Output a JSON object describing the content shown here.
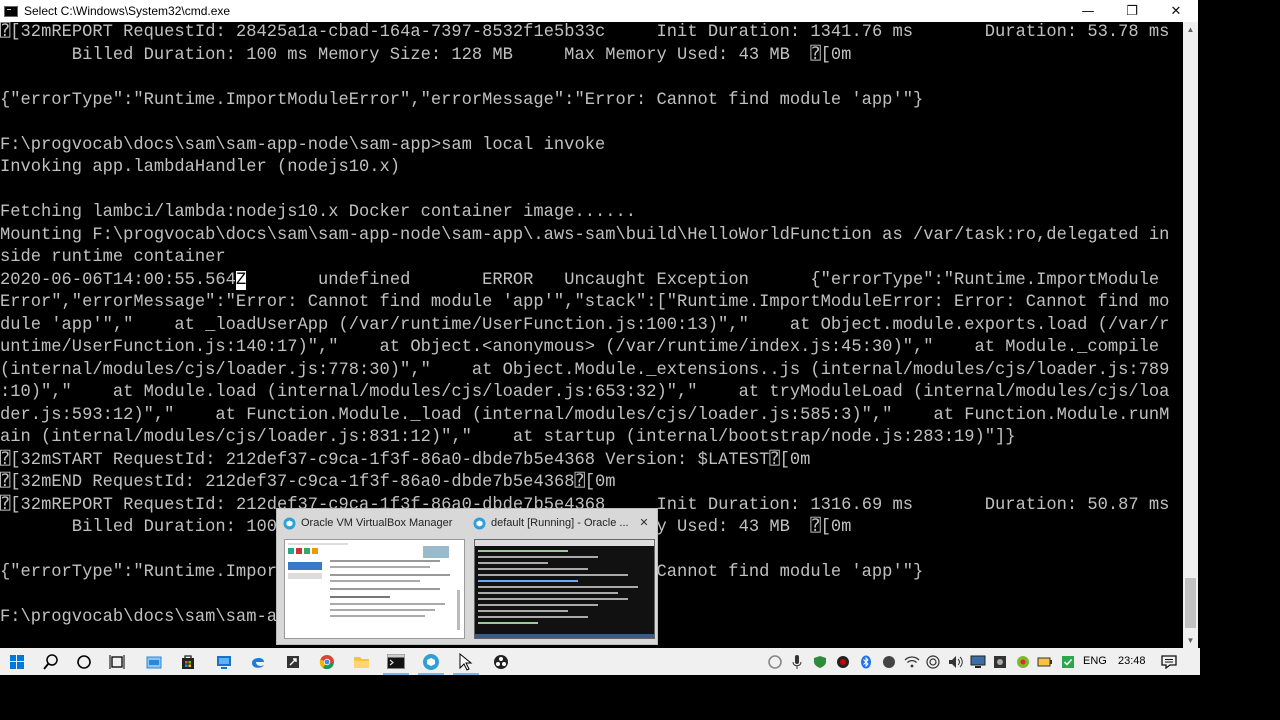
{
  "window": {
    "title": "Select C:\\Windows\\System32\\cmd.exe",
    "minimize_glyph": "—",
    "restore_glyph": "❐",
    "close_glyph": "✕"
  },
  "console": {
    "lines": [
      "\u0000[32mREPORT RequestId: 28425a1a-cbad-164a-7397-8532f1e5b33c     Init Duration: 1341.76 ms       Duration: 53.78 ms",
      "       Billed Duration: 100 ms Memory Size: 128 MB     Max Memory Used: 43 MB  \u0000[0m",
      "",
      "{\"errorType\":\"Runtime.ImportModuleError\",\"errorMessage\":\"Error: Cannot find module 'app'\"}",
      "",
      "F:\\progvocab\\docs\\sam\\sam-app-node\\sam-app>sam local invoke",
      "Invoking app.lambdaHandler (nodejs10.x)",
      "",
      "Fetching lambci/lambda:nodejs10.x Docker container image......",
      "Mounting F:\\progvocab\\docs\\sam\\sam-app-node\\sam-app\\.aws-sam\\build\\HelloWorldFunction as /var/task:ro,delegated in",
      "side runtime container",
      "2020-06-06T14:00:55.564",
      "Error\",\"errorMessage\":\"Error: Cannot find module 'app'\",\"stack\":[\"Runtime.ImportModuleError: Error: Cannot find mo",
      "dule 'app'\",\"    at _loadUserApp (/var/runtime/UserFunction.js:100:13)\",\"    at Object.module.exports.load (/var/r",
      "untime/UserFunction.js:140:17)\",\"    at Object.<anonymous> (/var/runtime/index.js:45:30)\",\"    at Module._compile",
      "(internal/modules/cjs/loader.js:778:30)\",\"    at Object.Module._extensions..js (internal/modules/cjs/loader.js:789",
      ":10)\",\"    at Module.load (internal/modules/cjs/loader.js:653:32)\",\"    at tryModuleLoad (internal/modules/cjs/loa",
      "der.js:593:12)\",\"    at Function.Module._load (internal/modules/cjs/loader.js:585:3)\",\"    at Function.Module.runM",
      "ain (internal/modules/cjs/loader.js:831:12)\",\"    at startup (internal/bootstrap/node.js:283:19)\"]}",
      "\u0000[32mSTART RequestId: 212def37-c9ca-1f3f-86a0-dbde7b5e4368 Version: $LATEST\u0000[0m",
      "\u0000[32mEND RequestId: 212def37-c9ca-1f3f-86a0-dbde7b5e4368\u0000[0m",
      "\u0000[32mREPORT RequestId: 212def37-c9ca-1f3f-86a0-dbde7b5e4368     Init Duration: 1316.69 ms       Duration: 50.87 ms",
      "       Billed Duration: 100 ms Memory Size: 128 MB     Max Memory Used: 43 MB  \u0000[0m",
      "",
      "{\"errorType\":\"Runtime.ImportModuleError\",\"errorMessage\":\"Error: Cannot find module 'app'\"}",
      "",
      "F:\\progvocab\\docs\\sam\\sam-app-node\\sam-app>"
    ],
    "cursor_char": "Z",
    "error_line_rest": "       undefined       ERROR   Uncaught Exception      {\"errorType\":\"Runtime.ImportModule"
  },
  "taskbar": {
    "icons": [
      {
        "name": "start-icon",
        "color": "#0078d7"
      },
      {
        "name": "search-icon",
        "color": "#000000"
      },
      {
        "name": "cortana-icon",
        "color": "#000000"
      },
      {
        "name": "task-view-icon",
        "color": "#000000"
      },
      {
        "name": "file-manager-icon",
        "color": "#2b88d8"
      },
      {
        "name": "store-icon",
        "color": "#000000"
      },
      {
        "name": "remote-desktop-icon",
        "color": "#1a73c9"
      },
      {
        "name": "edge-icon",
        "color": "#1e7bd7"
      },
      {
        "name": "app-icon",
        "color": "#333333"
      },
      {
        "name": "chrome-icon",
        "color": "#db4437"
      },
      {
        "name": "folder-icon",
        "color": "#f5c242"
      },
      {
        "name": "cmd-icon",
        "color": "#111111"
      },
      {
        "name": "virtualbox-icon",
        "color": "#2f9fd6"
      },
      {
        "name": "vm-icon",
        "color": "#444444"
      },
      {
        "name": "obs-icon",
        "color": "#222222"
      }
    ],
    "language": "ENG",
    "time": "23:48"
  },
  "preview": {
    "items": [
      {
        "title": "Oracle VM VirtualBox Manager",
        "icon_color": "#2f9fd6"
      },
      {
        "title": "default [Running] - Oracle ...",
        "icon_color": "#2f9fd6"
      }
    ],
    "close_glyph": "✕"
  }
}
